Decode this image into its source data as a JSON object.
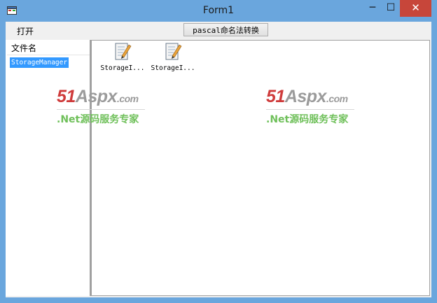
{
  "window": {
    "title": "Form1",
    "app_icon": "form-app-icon"
  },
  "window_controls": {
    "minimize": "─",
    "maximize": "☐",
    "close": "✕"
  },
  "menu": {
    "open_label": "打开"
  },
  "toolbar": {
    "pascal_button_label": "pascal命名法转换"
  },
  "tree": {
    "header": "文件名",
    "items": [
      {
        "label": "StorageManager",
        "selected": true
      }
    ]
  },
  "files": [
    {
      "label": "StorageI...",
      "icon": "document-edit-icon"
    },
    {
      "label": "StorageI...",
      "icon": "document-edit-icon"
    }
  ],
  "watermark": {
    "logo_num": "51",
    "logo_word": "Aspx",
    "logo_domain": ".com",
    "tagline": ".Net源码服务专家"
  },
  "colors": {
    "title_bar": "#6aa6dd",
    "close_button": "#c7463a",
    "selection": "#3399ff",
    "watermark_red": "#cf3b3b",
    "watermark_green": "#6fc05a"
  }
}
